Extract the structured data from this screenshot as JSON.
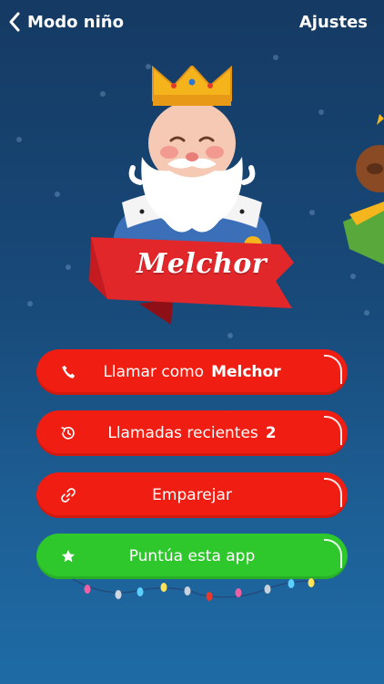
{
  "header": {
    "back_label": "Modo niño",
    "settings_label": "Ajustes"
  },
  "character": {
    "name": "Melchor"
  },
  "buttons": {
    "call": {
      "label": "Llamar como",
      "bold": "Melchor",
      "icon": "phone-icon"
    },
    "recent": {
      "label": "Llamadas recientes",
      "bold": "2",
      "icon": "history-icon"
    },
    "pair": {
      "label": "Emparejar",
      "icon": "link-icon"
    },
    "rate": {
      "label": "Puntúa esta app",
      "icon": "star-icon"
    }
  },
  "colors": {
    "background_top": "#153a63",
    "background_bottom": "#1e6ba6",
    "button_red": "#f01d12",
    "button_green": "#2ec72c"
  }
}
